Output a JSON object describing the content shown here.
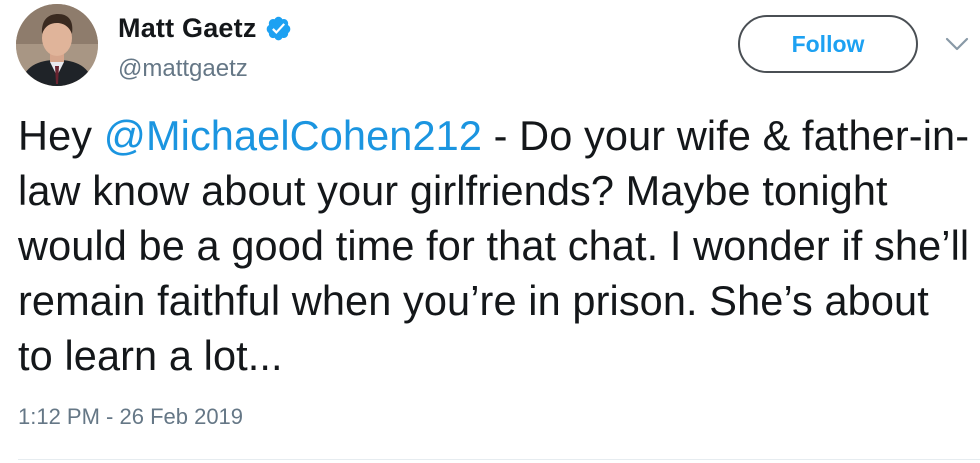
{
  "author": {
    "name": "Matt Gaetz",
    "handle": "@mattgaetz",
    "verified": true,
    "avatar_icon": "profile-photo"
  },
  "actions": {
    "follow_label": "Follow",
    "more_icon": "chevron-down-icon"
  },
  "tweet": {
    "text_before_mention": "Hey ",
    "mention": "@MichaelCohen212",
    "text_after_mention": " - Do your wife & father-in-law know about your girlfriends? Maybe tonight would be a good time for that chat. I wonder if she’ll remain faithful when you’re in prison.  She’s about to learn a lot...",
    "timestamp": "1:12 PM - 26 Feb 2019"
  },
  "colors": {
    "link": "#1b95e0",
    "follow_text": "#1da1f2",
    "verified_badge": "#1da1f2",
    "muted_text": "#657786",
    "body_text": "#14171a"
  }
}
